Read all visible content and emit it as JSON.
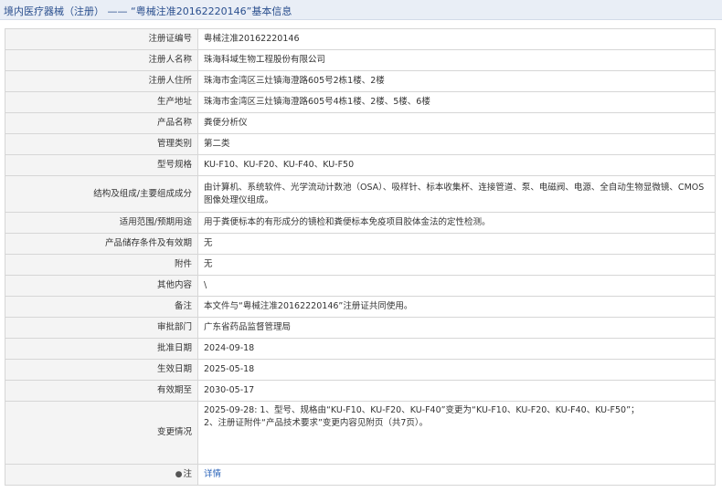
{
  "header": {
    "title": "境内医疗器械（注册） —— “粤械注准20162220146”基本信息"
  },
  "rows": [
    {
      "label": "注册证编号",
      "value": "粤械注准20162220146"
    },
    {
      "label": "注册人名称",
      "value": "珠海科域生物工程股份有限公司"
    },
    {
      "label": "注册人住所",
      "value": "珠海市金湾区三灶镇海澄路605号2栋1楼、2楼"
    },
    {
      "label": "生产地址",
      "value": "珠海市金湾区三灶镇海澄路605号4栋1楼、2楼、5楼、6楼"
    },
    {
      "label": "产品名称",
      "value": "粪便分析仪"
    },
    {
      "label": "管理类别",
      "value": "第二类"
    },
    {
      "label": "型号规格",
      "value": "KU-F10、KU-F20、KU-F40、KU-F50"
    },
    {
      "label": "结构及组成/主要组成成分",
      "value": "由计算机、系统软件、光学流动计数池（OSA）、吸样针、标本收集杯、连接管道、泵、电磁阀、电源、全自动生物显微镜、CMOS图像处理仪组成。"
    },
    {
      "label": "适用范围/预期用途",
      "value": "用于粪便标本的有形成分的镜检和粪便标本免疫项目胶体金法的定性检测。"
    },
    {
      "label": "产品储存条件及有效期",
      "value": "无"
    },
    {
      "label": "附件",
      "value": "无"
    },
    {
      "label": "其他内容",
      "value": "\\"
    },
    {
      "label": "备注",
      "value": "本文件与“粤械注准20162220146”注册证共同使用。"
    },
    {
      "label": "审批部门",
      "value": "广东省药品监督管理局"
    },
    {
      "label": "批准日期",
      "value": "2024-09-18"
    },
    {
      "label": "生效日期",
      "value": "2025-05-18"
    },
    {
      "label": "有效期至",
      "value": "2030-05-17"
    }
  ],
  "change": {
    "label": "变更情况",
    "line1": "2025-09-28: 1、型号、规格由“KU-F10、KU-F20、KU-F40”变更为“KU-F10、KU-F20、KU-F40、KU-F50”；",
    "line2": "2、注册证附件“产品技术要求”变更内容见附页（共7页）。"
  },
  "note": {
    "icon": "note-icon",
    "label": "注",
    "link": "详情"
  }
}
